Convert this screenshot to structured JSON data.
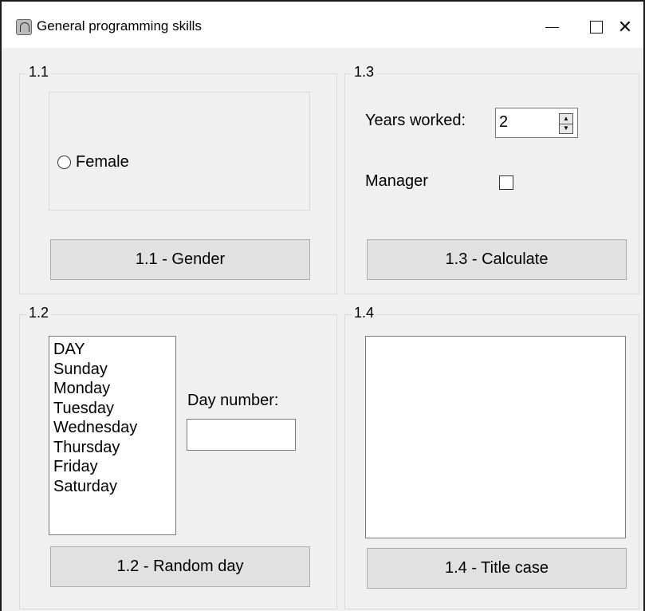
{
  "window": {
    "title": "General programming skills",
    "icon": "app-icon",
    "controls": {
      "close_glyph": "✕"
    }
  },
  "group_1_1": {
    "label": "1.1",
    "radio_label": "Female",
    "radio_checked": false,
    "button_label": "1.1 - Gender"
  },
  "group_1_3": {
    "label": "1.3",
    "years_label": "Years worked:",
    "years_value": "2",
    "manager_label": "Manager",
    "manager_checked": false,
    "button_label": "1.3 - Calculate"
  },
  "group_1_2": {
    "label": "1.2",
    "days": [
      "DAY",
      "Sunday",
      "Monday",
      "Tuesday",
      "Wednesday",
      "Thursday",
      "Friday",
      "Saturday"
    ],
    "day_number_label": "Day number:",
    "day_number_value": "",
    "button_label": "1.2 - Random day"
  },
  "group_1_4": {
    "label": "1.4",
    "output_text": "",
    "button_label": "1.4 - Title case"
  },
  "colors": {
    "window_bg": "#f0f0f0",
    "button_bg": "#e1e1e1",
    "button_border": "#adadad"
  }
}
